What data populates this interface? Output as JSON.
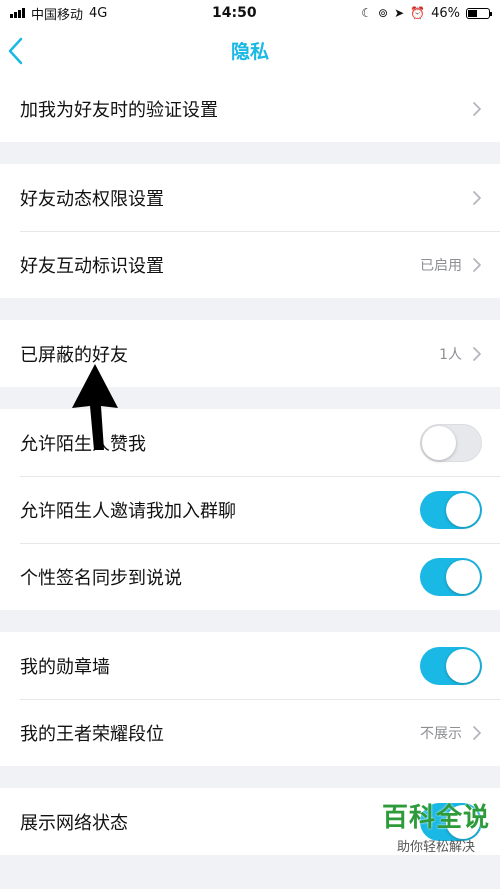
{
  "status_bar": {
    "carrier": "中国移动",
    "network": "4G",
    "time": "14:50",
    "battery": "46%",
    "battery_level": 0.46
  },
  "nav": {
    "title": "隐私",
    "back_icon": "chevron-left-icon"
  },
  "groups": [
    {
      "items": [
        {
          "label": "加我为好友时的验证设置",
          "type": "link",
          "value": ""
        }
      ]
    },
    {
      "items": [
        {
          "label": "好友动态权限设置",
          "type": "link",
          "value": ""
        },
        {
          "label": "好友互动标识设置",
          "type": "link",
          "value": "已启用"
        }
      ]
    },
    {
      "items": [
        {
          "label": "已屏蔽的好友",
          "type": "link",
          "value": "1人"
        }
      ]
    },
    {
      "items": [
        {
          "label": "允许陌生人赞我",
          "type": "toggle",
          "on": false
        },
        {
          "label": "允许陌生人邀请我加入群聊",
          "type": "toggle",
          "on": true
        },
        {
          "label": "个性签名同步到说说",
          "type": "toggle",
          "on": true
        }
      ]
    },
    {
      "items": [
        {
          "label": "我的勋章墙",
          "type": "toggle",
          "on": true
        },
        {
          "label": "我的王者荣耀段位",
          "type": "link",
          "value": "不展示"
        }
      ]
    },
    {
      "items": [
        {
          "label": "展示网络状态",
          "type": "toggle",
          "on": true
        }
      ]
    }
  ],
  "watermark": {
    "title": "百科全说",
    "subtitle": "助你轻松解决"
  },
  "colors": {
    "accent": "#1ab8e4",
    "background": "#f1f2f6",
    "toggle_off": "#e7e8ec",
    "watermark": "#2e9b3a"
  }
}
